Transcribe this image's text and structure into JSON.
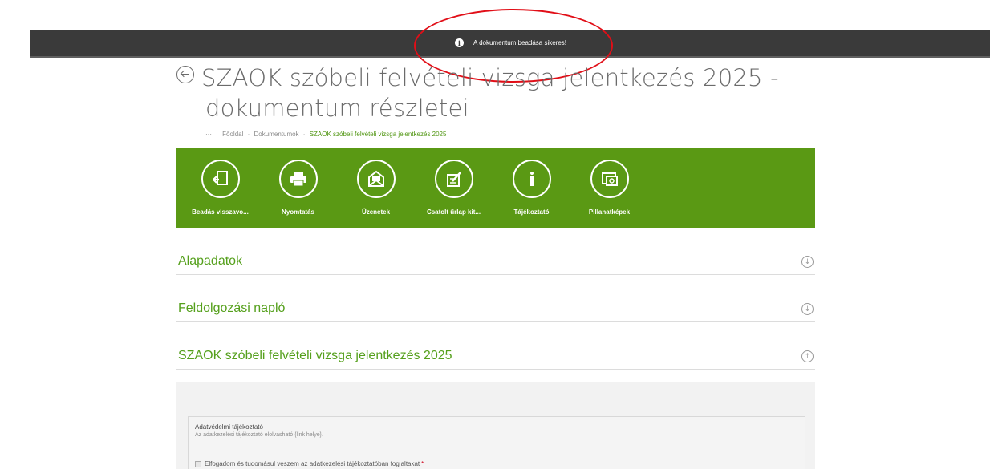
{
  "notification": {
    "icon": "info-icon",
    "message": "A dokumentum beadása sikeres!"
  },
  "page": {
    "title_line1": "SZAOK szóbeli felvételi vizsga jelentkezés 2025 -",
    "title_line2": "dokumentum részletei"
  },
  "breadcrumb": {
    "ellipsis": "···",
    "items": [
      "Főoldal",
      "Dokumentumok",
      "SZAOK szóbeli felvételi vizsga jelentkezés 2025"
    ]
  },
  "toolbar": {
    "items": [
      {
        "label": "Beadás visszavo...",
        "icon": "withdraw-icon"
      },
      {
        "label": "Nyomtatás",
        "icon": "print-icon"
      },
      {
        "label": "Üzenetek",
        "icon": "messages-icon"
      },
      {
        "label": "Csatolt űrlap kit...",
        "icon": "attached-form-icon"
      },
      {
        "label": "Tájékoztató",
        "icon": "info-icon"
      },
      {
        "label": "Pillanatképek",
        "icon": "snapshot-icon"
      }
    ]
  },
  "sections": [
    {
      "title": "Alapadatok",
      "state": "collapsed",
      "icon": "expand-down-icon",
      "glyph": "↓"
    },
    {
      "title": "Feldolgozási napló",
      "state": "collapsed",
      "icon": "expand-down-icon",
      "glyph": "↓"
    },
    {
      "title": "SZAOK szóbeli felvételi vizsga jelentkezés 2025",
      "state": "expanded",
      "icon": "collapse-up-icon",
      "glyph": "↑"
    }
  ],
  "form": {
    "privacy_title": "Adatvédelmi tájékoztató",
    "privacy_sub": "Az adatkezelési tájékoztató elolvasható {link helye}.",
    "consent_label": "Elfogadom és tudomásul veszem az adatkezelési tájékoztatóban foglaltakat",
    "required_mark": "*"
  },
  "colors": {
    "accent_green": "#5a9914",
    "notification_bg": "#3a3a3a",
    "highlight_red": "#e10e17"
  }
}
